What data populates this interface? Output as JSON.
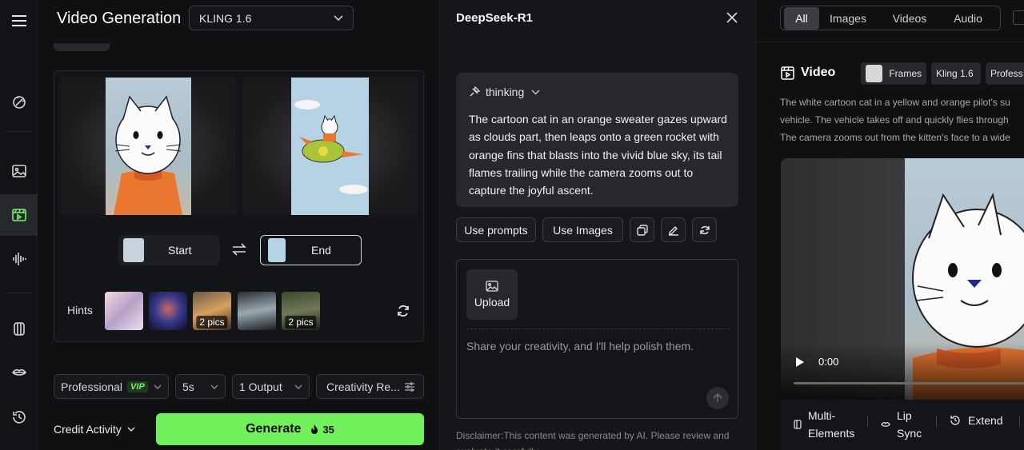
{
  "header": {
    "title": "Video Generation",
    "model_select": "KLING 1.6"
  },
  "frames": {
    "start_label": "Start",
    "end_label": "End"
  },
  "hints": {
    "label": "Hints",
    "badges": [
      "2 pics",
      "2 pics"
    ]
  },
  "options": {
    "mode": "Professional",
    "vip": "VIP",
    "duration": "5s",
    "outputs": "1 Output",
    "creativity": "Creativity Re..."
  },
  "footer": {
    "credit_activity": "Credit Activity",
    "generate_label": "Generate",
    "cost": "35"
  },
  "assistant": {
    "title": "DeepSeek-R1",
    "thinking_label": "thinking",
    "response": "The cartoon cat in an orange sweater gazes upward as clouds part, then leaps onto a green rocket with orange fins that blasts into the vivid blue sky, its tail flames trailing while the camera zooms out to capture the joyful ascent.",
    "use_prompts": "Use prompts",
    "use_images": "Use Images",
    "upload_label": "Upload",
    "input_placeholder": "Share your creativity, and I'll help polish them.",
    "disclaimer": "Disclaimer:This content was generated by AI. Please review and evaluate it carefully."
  },
  "library": {
    "tabs": [
      "All",
      "Images",
      "Videos",
      "Audio"
    ],
    "active_tab": "All",
    "section_title": "Video",
    "chips": [
      "Frames",
      "Kling 1.6",
      "Profess"
    ],
    "description_lines": [
      "The white cartoon cat in a yellow and orange pilot's su",
      "vehicle. The vehicle takes off and quickly flies through",
      "The camera zooms out from the kitten's face to a wide"
    ],
    "video_time": "0:00",
    "actions": {
      "multi_elements_1": "Multi-",
      "multi_elements_2": "Elements",
      "lip_sync_1": "Lip",
      "lip_sync_2": "Sync",
      "extend": "Extend"
    }
  },
  "colors": {
    "accent": "#72f05b",
    "background": "#0f1012",
    "panel": "#151619"
  }
}
